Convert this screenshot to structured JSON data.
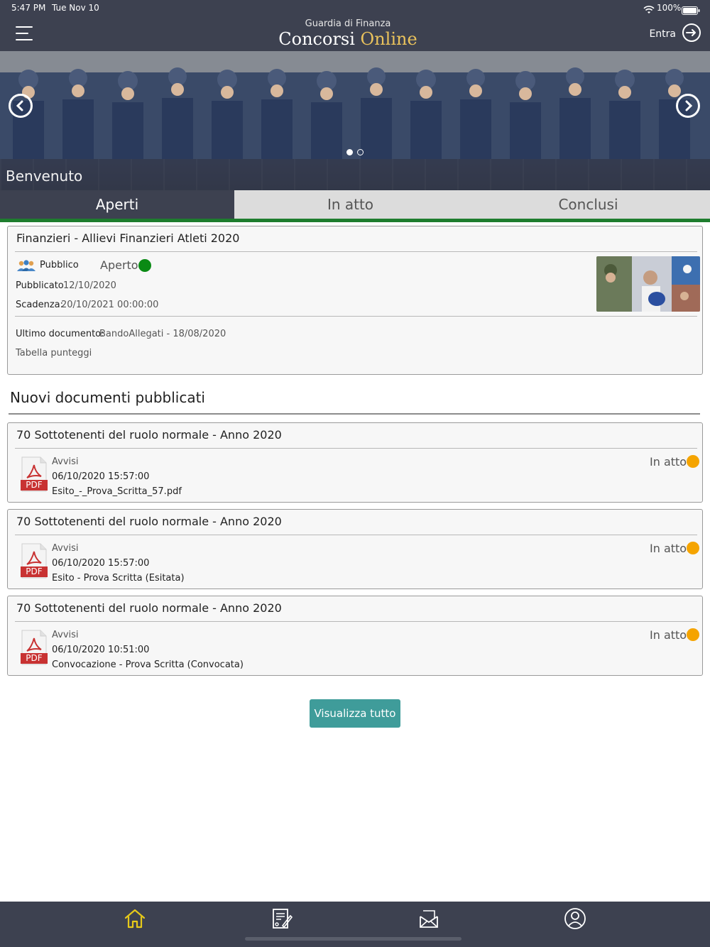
{
  "status_bar": {
    "time": "5:47 PM",
    "date": "Tue Nov 10",
    "battery": "100%"
  },
  "header": {
    "logo_subtitle": "Guardia di Finanza",
    "logo_title_part1": "Concorsi ",
    "logo_title_part2": "Online",
    "login_label": "Entra"
  },
  "carousel": {
    "caption": "Benvenuto",
    "slide_count": 2,
    "active_slide": 1
  },
  "tabs": [
    {
      "label": "Aperti",
      "active": true
    },
    {
      "label": "In atto",
      "active": false
    },
    {
      "label": "Conclusi",
      "active": false
    }
  ],
  "featured": {
    "title": "Finanzieri - Allievi Finanzieri Atleti 2020",
    "audience": "Pubblico",
    "status": "Aperto",
    "status_color": "#0a8a14",
    "published_label": "Pubblicato",
    "published_value": "12/10/2020",
    "deadline_label": "Scadenza:",
    "deadline_value": "20/10/2021 00:00:00",
    "last_doc_label": "Ultimo documento:",
    "last_doc_value": "BandoAllegati - 18/08/2020",
    "scores_link": "Tabella punteggi"
  },
  "new_docs": {
    "section_title": "Nuovi documenti pubblicati",
    "items": [
      {
        "title": "70 Sottotenenti del ruolo normale - Anno 2020",
        "category": "Avvisi",
        "datetime": "06/10/2020 15:57:00",
        "filename": "Esito_-_Prova_Scritta_57.pdf",
        "status": "In atto",
        "file_type": "PDF"
      },
      {
        "title": "70 Sottotenenti del ruolo normale - Anno 2020",
        "category": "Avvisi",
        "datetime": "06/10/2020 15:57:00",
        "filename": "Esito - Prova Scritta (Esitata)",
        "status": "In atto",
        "file_type": "PDF"
      },
      {
        "title": "70 Sottotenenti del ruolo normale - Anno 2020",
        "category": "Avvisi",
        "datetime": "06/10/2020 10:51:00",
        "filename": "Convocazione - Prova Scritta (Convocata)",
        "status": "In atto",
        "file_type": "PDF"
      }
    ],
    "status_color": "#f5a400",
    "view_all_label": "Visualizza tutto"
  },
  "bottom_nav": [
    {
      "icon": "home-icon",
      "active": true
    },
    {
      "icon": "document-edit-icon",
      "active": false
    },
    {
      "icon": "mail-icon",
      "active": false
    },
    {
      "icon": "user-icon",
      "active": false
    }
  ],
  "colors": {
    "header_bg": "#3d4150",
    "accent_green": "#1e7d2e",
    "button_teal": "#3f9c9a",
    "active_nav": "#e6c91a"
  }
}
